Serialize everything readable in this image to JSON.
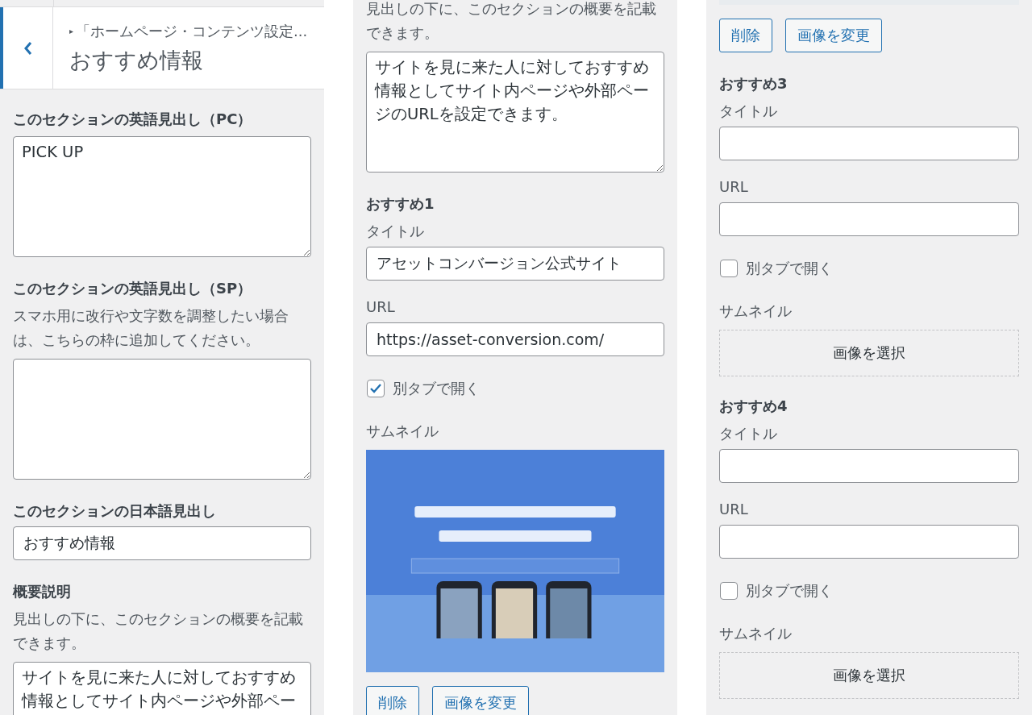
{
  "header": {
    "breadcrumb_arrow": "▸",
    "breadcrumb": "「ホームページ・コンテンツ設定...",
    "title": "おすすめ情報"
  },
  "columns": [
    {
      "items": [
        {
          "kind": "heading",
          "text": "このセクションの英語見出し（PC）"
        },
        {
          "kind": "textarea",
          "value": "PICK UP"
        },
        {
          "kind": "heading",
          "text": "このセクションの英語見出し（SP）"
        },
        {
          "kind": "description",
          "text": "スマホ用に改行や文字数を調整したい場合は、こちらの枠に追加してください。"
        },
        {
          "kind": "textarea",
          "value": ""
        },
        {
          "kind": "heading",
          "text": "このセクションの日本語見出し"
        },
        {
          "kind": "input",
          "value": "おすすめ情報"
        },
        {
          "kind": "heading",
          "text": "概要説明"
        },
        {
          "kind": "description",
          "text": "見出しの下に、このセクションの概要を記載できます。"
        },
        {
          "kind": "textarea",
          "value": "サイトを見に来た人に対しておすすめ情報としてサイト内ページや外部ペー"
        }
      ]
    },
    {
      "items": [
        {
          "kind": "description",
          "text": "見出しの下に、このセクションの概要を記載できます。"
        },
        {
          "kind": "textarea",
          "value": "サイトを見に来た人に対しておすすめ情報としてサイト内ページや外部ページのURLを設定できます。"
        },
        {
          "kind": "heading",
          "text": "おすすめ1"
        },
        {
          "kind": "label",
          "text": "タイトル"
        },
        {
          "kind": "input",
          "value": "アセットコンバージョン公式サイト"
        },
        {
          "kind": "label",
          "text": "URL"
        },
        {
          "kind": "input",
          "value": "https://asset-conversion.com/"
        },
        {
          "kind": "checkbox",
          "label": "別タブで開く",
          "checked": true
        },
        {
          "kind": "label",
          "text": "サムネイル"
        },
        {
          "kind": "picture"
        },
        {
          "kind": "buttons",
          "buttons": [
            "削除",
            "画像を変更"
          ]
        }
      ]
    },
    {
      "items": [
        {
          "kind": "picture"
        },
        {
          "kind": "buttons",
          "buttons": [
            "削除",
            "画像を変更"
          ]
        },
        {
          "kind": "heading",
          "text": "おすすめ3"
        },
        {
          "kind": "label",
          "text": "タイトル"
        },
        {
          "kind": "input",
          "value": ""
        },
        {
          "kind": "label",
          "text": "URL"
        },
        {
          "kind": "input",
          "value": ""
        },
        {
          "kind": "checkbox",
          "label": "別タブで開く",
          "checked": false
        },
        {
          "kind": "label",
          "text": "サムネイル"
        },
        {
          "kind": "select",
          "label": "画像を選択"
        },
        {
          "kind": "heading",
          "text": "おすすめ4"
        },
        {
          "kind": "label",
          "text": "タイトル"
        },
        {
          "kind": "input",
          "value": ""
        },
        {
          "kind": "label",
          "text": "URL"
        },
        {
          "kind": "input",
          "value": ""
        },
        {
          "kind": "checkbox",
          "label": "別タブで開く",
          "checked": false
        },
        {
          "kind": "label",
          "text": "サムネイル"
        },
        {
          "kind": "select",
          "label": "画像を選択"
        }
      ]
    }
  ]
}
